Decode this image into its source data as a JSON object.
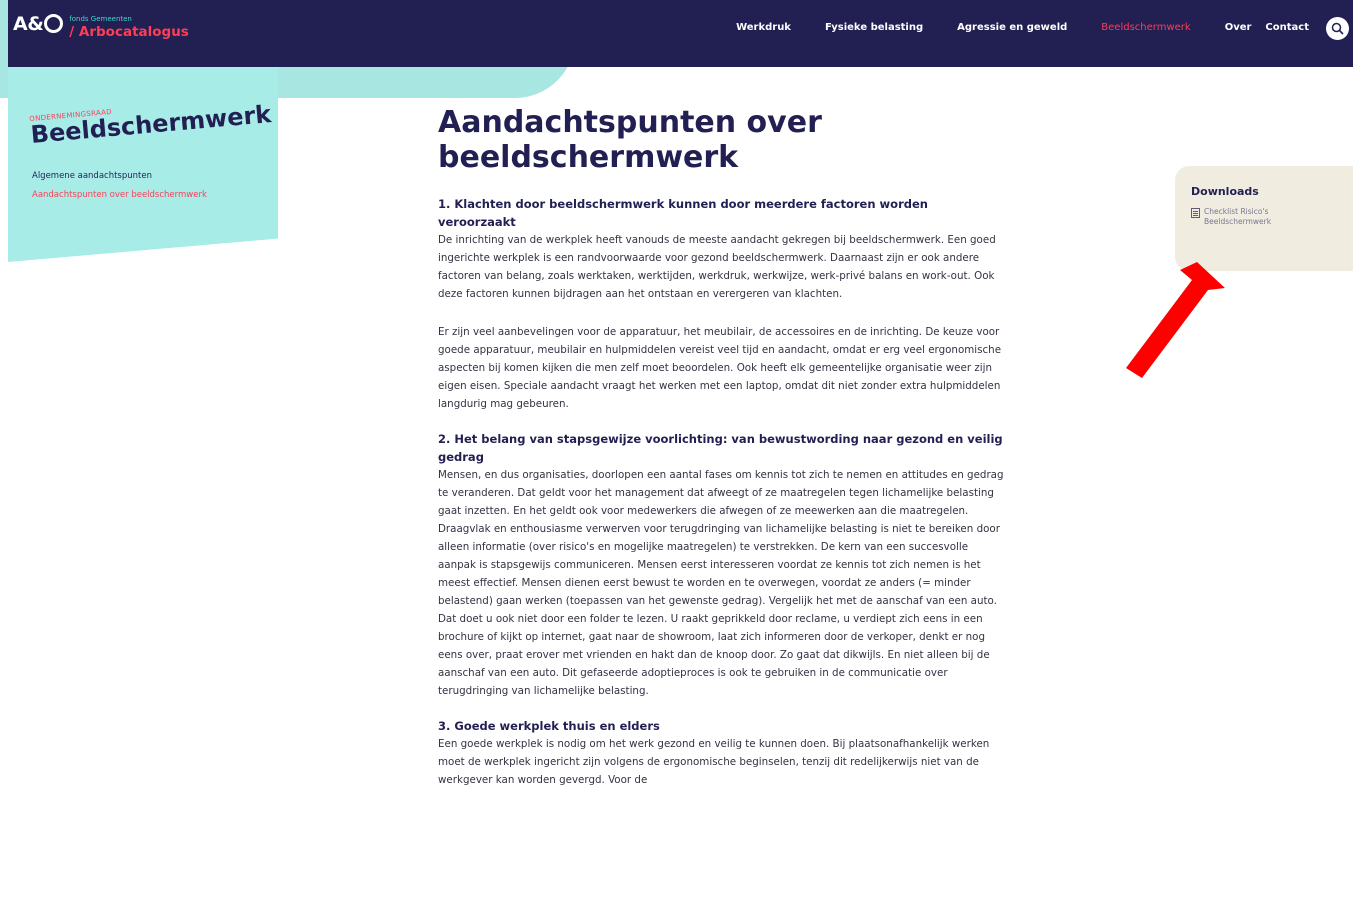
{
  "nav": {
    "logo_ao": "A&",
    "logo_small": "fonds Gemeenten",
    "logo_big": "/ Arbocatalogus",
    "links": [
      "Werkdruk",
      "Fysieke belasting",
      "Agressie en geweld",
      "Beeldschermwerk",
      "Over",
      "Contact"
    ],
    "active": "Beeldschermwerk",
    "search_icon": "search-icon"
  },
  "sidebar": {
    "kicker": "ONDERNEMINGSRAAD",
    "title": "Beeldschermwerk",
    "items": [
      "Algemene aandachtspunten",
      "Aandachtspunten over beeldschermwerk"
    ],
    "active_item": "Aandachtspunten over beeldschermwerk"
  },
  "main": {
    "title": "Aandachtspunten over beeldschermwerk",
    "sections": [
      {
        "title": "1. Klachten door beeldschermwerk kunnen door meerdere factoren worden veroorzaakt",
        "paragraphs": [
          "De inrichting van de werkplek heeft vanouds de meeste aandacht gekregen bij beeldschermwerk. Een goed ingerichte werkplek is een randvoorwaarde voor gezond beeldschermwerk. Daarnaast zijn er ook andere factoren van belang, zoals werktaken, werktijden, werkdruk, werkwijze, werk-privé balans en work-out. Ook deze factoren kunnen bijdragen aan het ontstaan en verergeren van klachten.",
          "Er zijn veel aanbevelingen voor de apparatuur, het meubilair, de accessoires en de inrichting. De keuze voor goede apparatuur, meubilair en hulpmiddelen vereist veel tijd en aandacht, omdat er erg veel ergonomische aspecten bij komen kijken die men zelf moet beoordelen. Ook heeft elk gemeentelijke organisatie weer zijn eigen eisen. Speciale aandacht vraagt het werken met een laptop, omdat dit niet zonder extra hulpmiddelen langdurig mag gebeuren."
        ]
      },
      {
        "title": "2. Het belang van stapsgewijze voorlichting: van bewustwording naar gezond en veilig gedrag",
        "paragraphs": [
          "Mensen, en dus organisaties, doorlopen een aantal fases om kennis tot zich te nemen en attitudes en gedrag te veranderen. Dat geldt voor het management dat afweegt of ze maatregelen tegen lichamelijke belasting gaat inzetten. En het geldt ook voor medewerkers die afwegen of ze meewerken aan die maatregelen. Draagvlak en enthousiasme verwerven voor terugdringing van lichamelijke belasting is niet te bereiken door alleen informatie (over risico's en mogelijke maatregelen) te verstrekken. De kern van een succesvolle aanpak is stapsgewijs communiceren. Mensen eerst interesseren voordat ze kennis tot zich nemen is het meest effectief. Mensen dienen eerst bewust te worden en te overwegen, voordat ze anders (= minder belastend) gaan werken (toepassen van het gewenste gedrag). Vergelijk het met de aanschaf van een auto. Dat doet u ook niet door een folder te lezen. U raakt geprikkeld door reclame, u verdiept zich eens in een brochure of kijkt op internet, gaat naar de showroom, laat zich informeren door de verkoper, denkt er nog eens over, praat erover met vrienden en hakt dan de knoop door. Zo gaat dat dikwijls. En niet alleen bij de aanschaf van een auto. Dit gefaseerde adoptieproces is ook te gebruiken in de communicatie over terugdringing van lichamelijke belasting."
        ]
      },
      {
        "title": "3. Goede werkplek thuis en elders",
        "paragraphs": [
          "Een goede werkplek is nodig om het werk gezond en veilig te kunnen doen. Bij plaatsonafhankelijk werken moet de werkplek ingericht zijn volgens de ergonomische beginselen, tenzij dit redelijkerwijs niet van de werkgever kan worden gevergd. Voor de"
        ]
      }
    ]
  },
  "downloads": {
    "title": "Downloads",
    "items": [
      {
        "label": "Checklist Risico's Beeldschermwerk",
        "icon": "document-icon"
      }
    ]
  },
  "annotation": {
    "color": "#ff0000",
    "icon": "arrow-icon"
  }
}
